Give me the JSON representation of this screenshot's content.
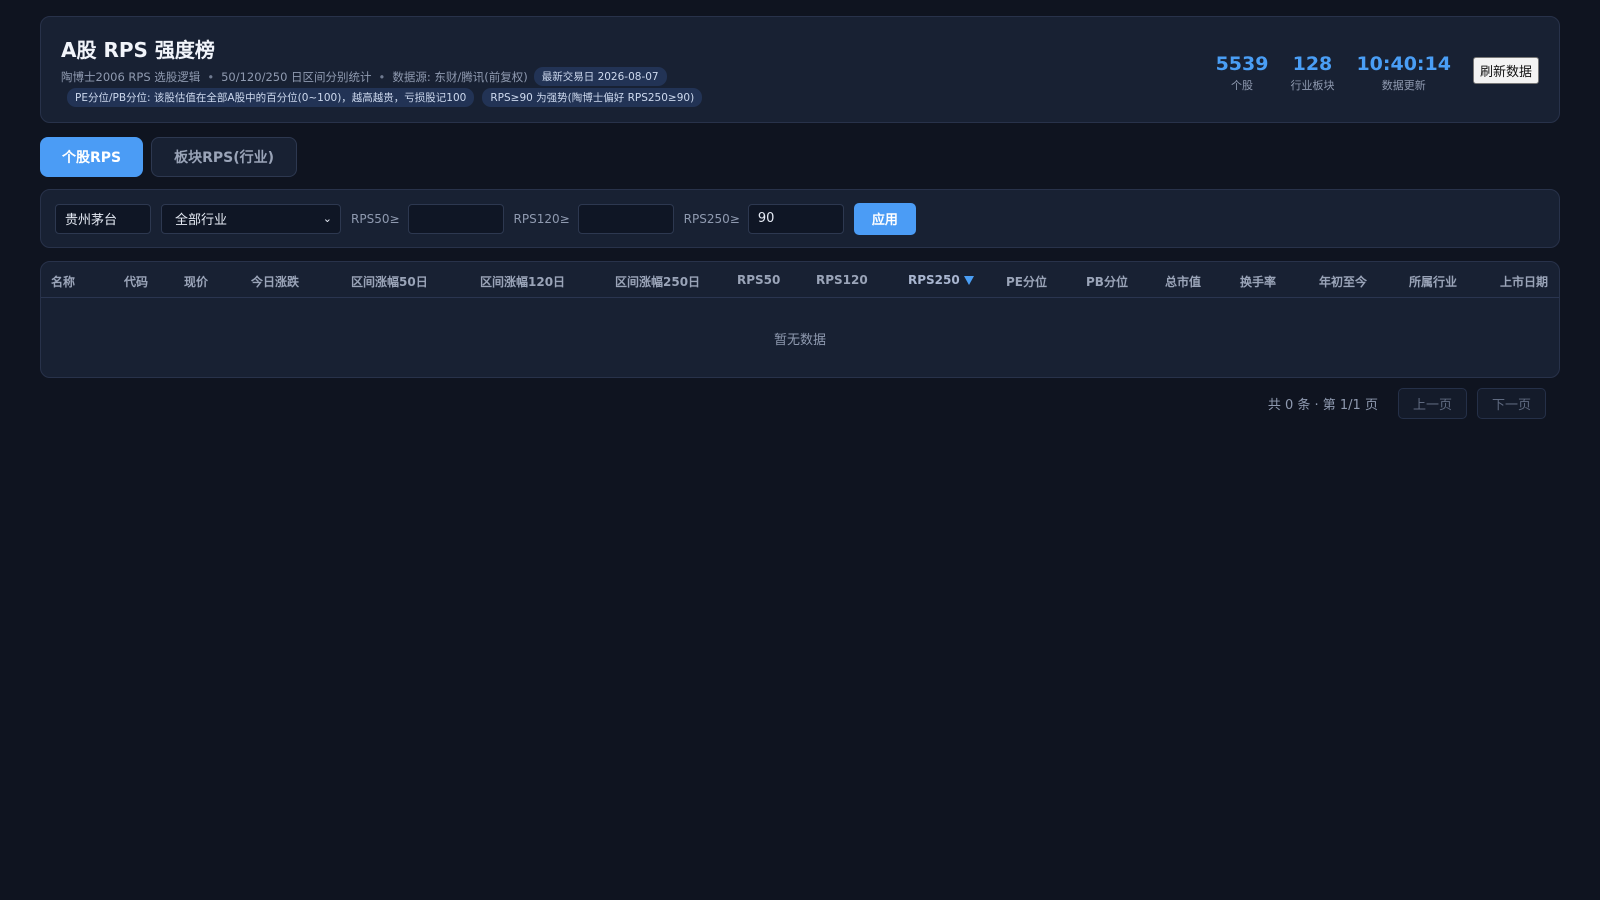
{
  "header": {
    "title": "A股 RPS 强度榜",
    "meta": [
      "陶博士2006 RPS 选股逻辑",
      "50/120/250 日区间分别统计",
      "数据源: 东财/腾讯(前复权)"
    ],
    "meta_separator": "•",
    "trade_date_badge": "最新交易日 2026-08-07",
    "notes": [
      "PE分位/PB分位: 该股估值在全部A股中的百分位(0~100)，越高越贵，亏损股记100",
      "RPS≥90 为强势(陶博士偏好 RPS250≥90)"
    ],
    "stats": [
      {
        "value": "5539",
        "label": "个股"
      },
      {
        "value": "128",
        "label": "行业板块"
      },
      {
        "value": "10:40:14",
        "label": "数据更新"
      }
    ],
    "refresh_label": "刷新数据"
  },
  "tabs": [
    {
      "label": "个股RPS",
      "active": true
    },
    {
      "label": "板块RPS(行业)",
      "active": false
    }
  ],
  "filters": {
    "keyword_value": "贵州茅台",
    "industry_selected": "全部行业",
    "rps50_label": "RPS50≥",
    "rps50_value": "",
    "rps120_label": "RPS120≥",
    "rps120_value": "",
    "rps250_label": "RPS250≥",
    "rps250_value": "90",
    "apply_label": "应用"
  },
  "table": {
    "columns": [
      "名称",
      "代码",
      "现价",
      "今日涨跌",
      "区间涨幅50日",
      "区间涨幅120日",
      "区间涨幅250日",
      "RPS50",
      "RPS120",
      "RPS250",
      "PE分位",
      "PB分位",
      "总市值",
      "换手率",
      "年初至今",
      "所属行业",
      "上市日期"
    ],
    "sorted_column": "RPS250",
    "sort_direction": "desc",
    "empty_text": "暂无数据",
    "rows": []
  },
  "pager": {
    "info": "共 0 条 · 第 1/1 页",
    "prev_label": "上一页",
    "next_label": "下一页"
  },
  "colors": {
    "accent": "#4b9cf5",
    "background": "#0f1420",
    "card": "#182133"
  }
}
